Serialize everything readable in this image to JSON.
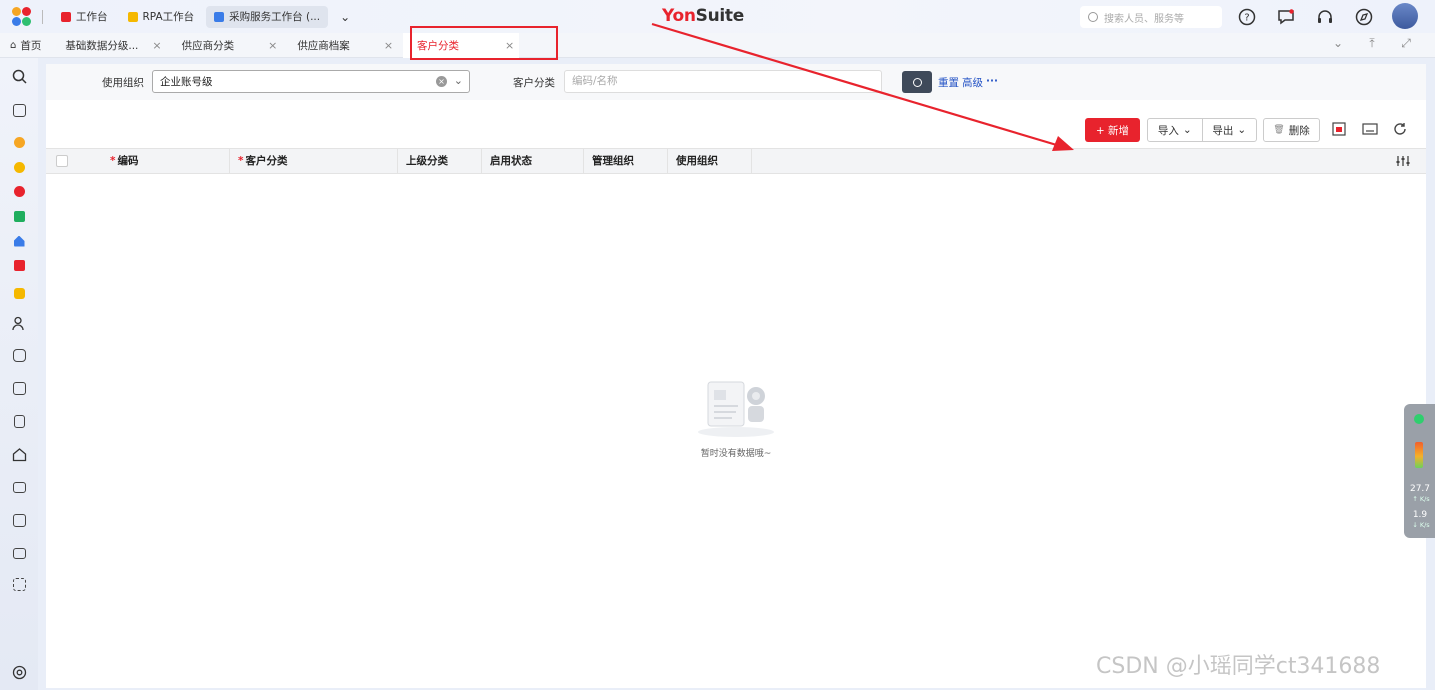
{
  "topbar": {
    "app_tabs": [
      {
        "label": "工作台",
        "color": "#e8232d"
      },
      {
        "label": "RPA工作台",
        "color": "#f5b800"
      },
      {
        "label": "采购服务工作台 (...",
        "color": "#3a7ce8"
      }
    ],
    "brand_left": "Yon",
    "brand_right": "Suite",
    "search_placeholder": "搜索人员、服务等",
    "icons": [
      "help-icon",
      "message-icon",
      "headset-icon",
      "compass-icon"
    ]
  },
  "tabs": [
    {
      "label": "首页",
      "closable": false
    },
    {
      "label": "基础数据分级...",
      "closable": true
    },
    {
      "label": "供应商分类",
      "closable": true
    },
    {
      "label": "供应商档案",
      "closable": true
    },
    {
      "label": "客户分类",
      "closable": true,
      "current": true
    }
  ],
  "tab_close_glyph": "×",
  "filter": {
    "org_label": "使用组织",
    "org_value": "企业账号级",
    "category_label": "客户分类",
    "category_placeholder": "编码/名称",
    "reset_label": "重置",
    "advanced_label": "高级",
    "more_label": "···"
  },
  "toolbar": {
    "new_label": "+ 新增",
    "import_label": "导入",
    "export_label": "导出",
    "delete_label": "删除"
  },
  "table": {
    "columns": [
      {
        "label": "编码",
        "required": true
      },
      {
        "label": "客户分类",
        "required": true
      },
      {
        "label": "上级分类",
        "required": false
      },
      {
        "label": "启用状态",
        "required": false
      },
      {
        "label": "管理组织",
        "required": false
      },
      {
        "label": "使用组织",
        "required": false
      }
    ],
    "rows": [],
    "empty_text": "暂时没有数据哦~"
  },
  "net_widget": {
    "up_value": "27.7",
    "up_unit": "K/s",
    "down_value": "1.9",
    "down_unit": "K/s"
  },
  "watermark": "CSDN @小瑶同学ct341688",
  "colors": {
    "accent": "#e8232d",
    "link": "#2856c6",
    "annotation": "#e8232d"
  }
}
